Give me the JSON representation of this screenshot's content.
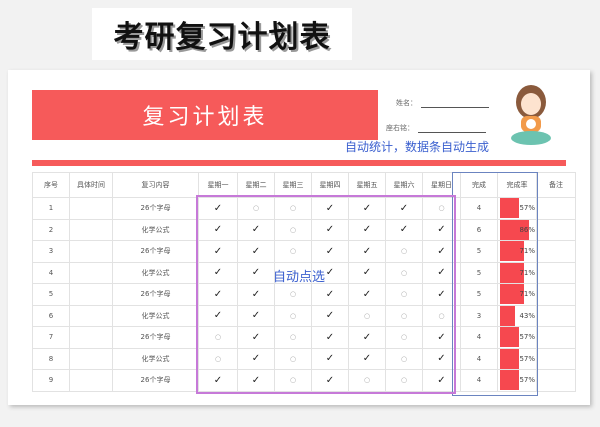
{
  "top_title": "考研复习计划表",
  "banner_title": "复习计划表",
  "fields": {
    "name_label": "姓名：",
    "motto_label": "座右铭："
  },
  "annotations": {
    "auto_stat": "自动统计，数据条自动生成",
    "auto_select": "自动点选"
  },
  "headers": [
    "序号",
    "具体时间",
    "复习内容",
    "星期一",
    "星期二",
    "星期三",
    "星期四",
    "星期五",
    "星期六",
    "星期日",
    "完成",
    "完成率",
    "备注"
  ],
  "symbols": {
    "done": "✓",
    "todo": "○"
  },
  "colors": {
    "accent": "#f65a5a",
    "bar": "#f6484f",
    "annotation": "#3a5fcf"
  },
  "rows": [
    {
      "no": "1",
      "time": "",
      "content": "26个字母",
      "days": [
        1,
        0,
        0,
        1,
        1,
        1,
        0
      ],
      "done": "4",
      "rate": "57%",
      "rate_value": 57,
      "note": ""
    },
    {
      "no": "2",
      "time": "",
      "content": "化学公式",
      "days": [
        1,
        1,
        0,
        1,
        1,
        1,
        1
      ],
      "done": "6",
      "rate": "86%",
      "rate_value": 86,
      "note": ""
    },
    {
      "no": "3",
      "time": "",
      "content": "26个字母",
      "days": [
        1,
        1,
        0,
        1,
        1,
        0,
        1
      ],
      "done": "5",
      "rate": "71%",
      "rate_value": 71,
      "note": ""
    },
    {
      "no": "4",
      "time": "",
      "content": "化学公式",
      "days": [
        1,
        1,
        0,
        1,
        1,
        0,
        1
      ],
      "done": "5",
      "rate": "71%",
      "rate_value": 71,
      "note": ""
    },
    {
      "no": "5",
      "time": "",
      "content": "26个字母",
      "days": [
        1,
        1,
        0,
        1,
        1,
        0,
        1
      ],
      "done": "5",
      "rate": "71%",
      "rate_value": 71,
      "note": ""
    },
    {
      "no": "6",
      "time": "",
      "content": "化学公式",
      "days": [
        1,
        1,
        0,
        1,
        0,
        0,
        0
      ],
      "done": "3",
      "rate": "43%",
      "rate_value": 43,
      "note": ""
    },
    {
      "no": "7",
      "time": "",
      "content": "26个字母",
      "days": [
        0,
        1,
        0,
        1,
        1,
        0,
        1
      ],
      "done": "4",
      "rate": "57%",
      "rate_value": 57,
      "note": ""
    },
    {
      "no": "8",
      "time": "",
      "content": "化学公式",
      "days": [
        0,
        1,
        0,
        1,
        1,
        0,
        1
      ],
      "done": "4",
      "rate": "57%",
      "rate_value": 57,
      "note": ""
    },
    {
      "no": "9",
      "time": "",
      "content": "26个字母",
      "days": [
        1,
        1,
        0,
        1,
        0,
        0,
        1
      ],
      "done": "4",
      "rate": "57%",
      "rate_value": 57,
      "note": ""
    }
  ]
}
